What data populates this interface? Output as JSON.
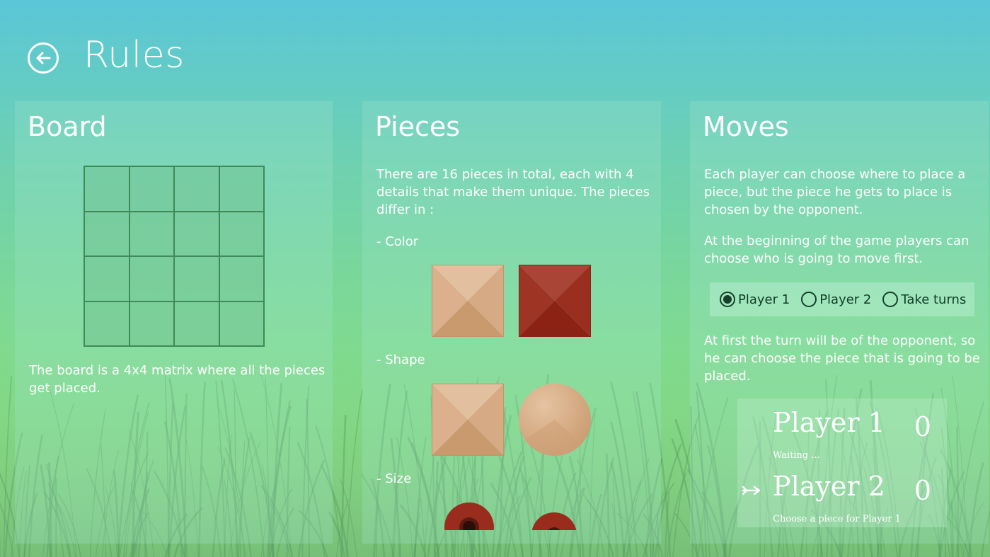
{
  "header": {
    "title": "Rules",
    "back_icon": "arrow-left-icon"
  },
  "board": {
    "title": "Board",
    "grid_rows": 4,
    "grid_cols": 4,
    "description": "The board is a 4x4 matrix where all the pieces get placed."
  },
  "pieces": {
    "title": "Pieces",
    "intro": "There are 16 pieces in total, each with 4 details that make them unique. The pieces differ in  :",
    "color_label": "- Color",
    "shape_label": "- Shape",
    "size_label": "- Size",
    "colors": {
      "light": "#d9a77e",
      "dark": "#9a2c1e"
    }
  },
  "moves": {
    "title": "Moves",
    "p1": "Each player can choose where to place a piece, but the piece he gets to place is chosen by the opponent.",
    "p2": "At the beginning of the game players can choose who is going to move first.",
    "options": [
      "Player 1",
      "Player 2",
      "Take turns"
    ],
    "selected_option": "Player 1",
    "p3": "At first the turn will be of the opponent, so he can choose the piece that is going to be placed.",
    "scoreboard": {
      "player1_name": "Player 1",
      "player1_score": "0",
      "player1_status": "Waiting ...",
      "player2_name": "Player 2",
      "player2_score": "0",
      "player2_status": "Choose a piece for Player 1",
      "turn_icon": "arrow-right-icon"
    }
  }
}
